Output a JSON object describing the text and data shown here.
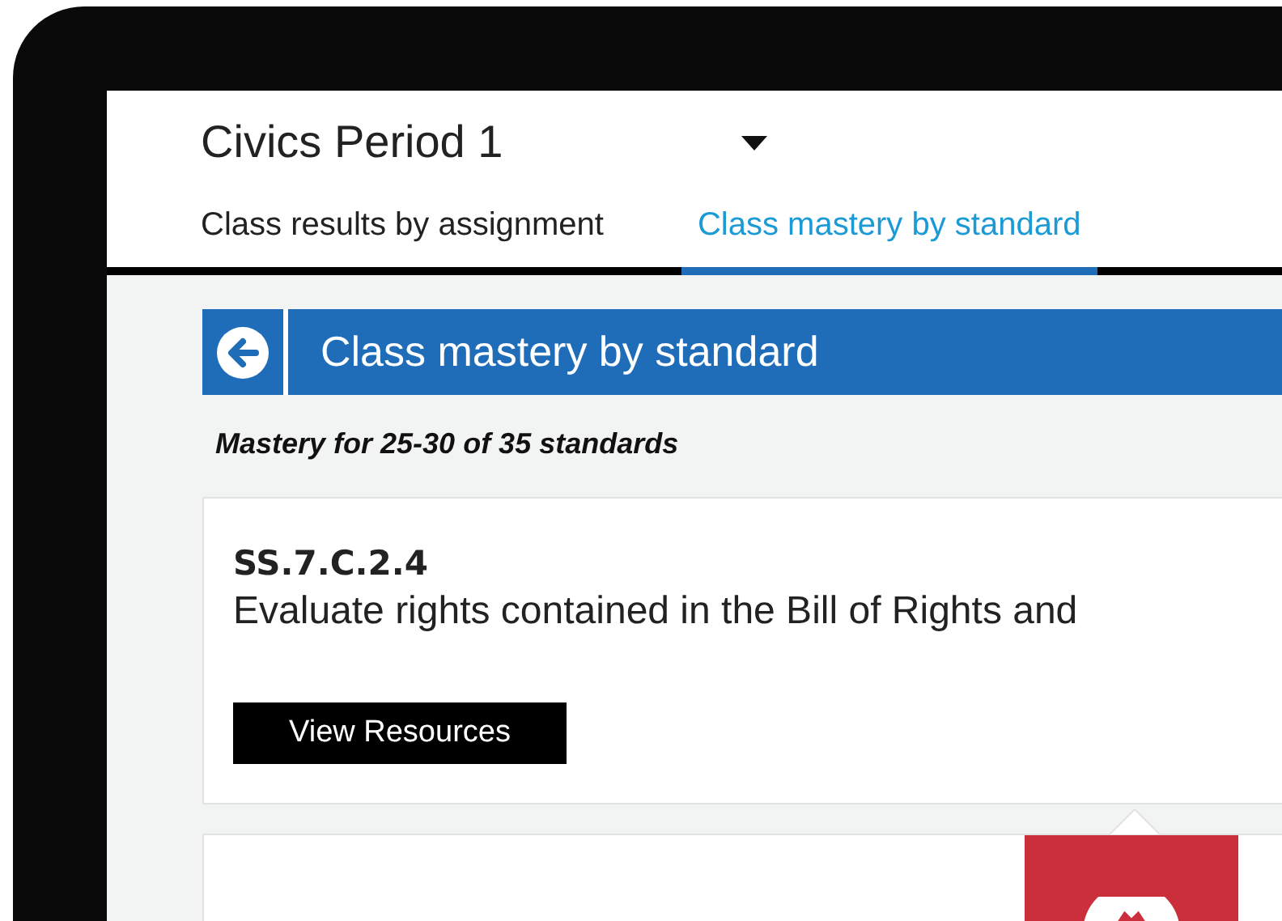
{
  "header": {
    "class_selector": "Civics Period 1"
  },
  "tabs": [
    {
      "label": "Class results by assignment",
      "selected": false
    },
    {
      "label": "Class mastery by standard",
      "selected": true
    }
  ],
  "section": {
    "title": "Class mastery by standard",
    "subtitle": "Mastery for 25-30 of 35 standards"
  },
  "standard": {
    "code": "SS.7.C.2.4",
    "description": "Evaluate rights contained in the Bill of Rights and",
    "button": "View Resources"
  }
}
